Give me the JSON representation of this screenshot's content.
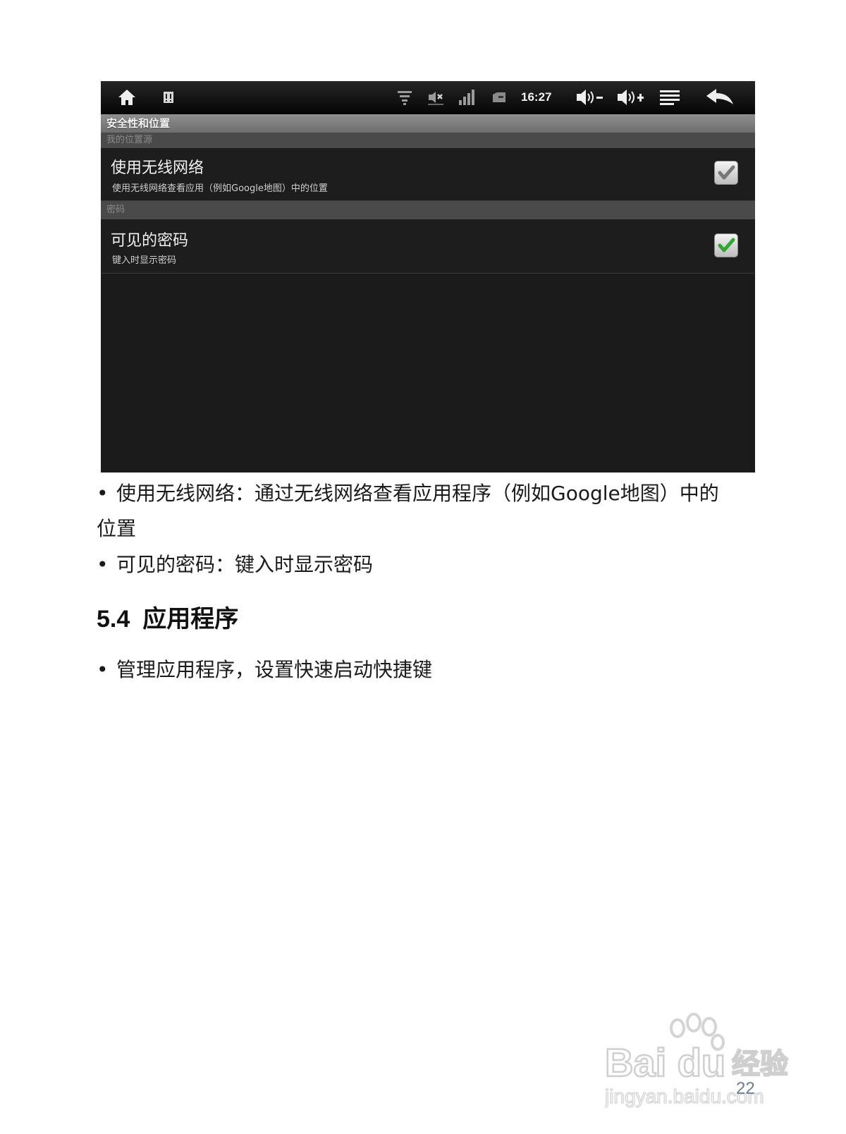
{
  "screenshot": {
    "statusbar": {
      "time": "16:27",
      "icons": [
        "home-icon",
        "notification-icon",
        "wifi-icon",
        "mute-icon",
        "signal-icon",
        "battery-icon",
        "volume-down-icon",
        "volume-up-icon",
        "menu-icon",
        "back-icon"
      ]
    },
    "header_title": "安全性和位置",
    "section_location": "我的位置源",
    "wireless": {
      "title": "使用无线网络",
      "summary": "使用无线网络查看应用（例如Google地图）中的位置",
      "checked": true,
      "check_color": "#7a7a7a"
    },
    "section_password": "密码",
    "visible_password": {
      "title": "可见的密码",
      "summary": "键入时显示密码",
      "checked": true,
      "check_color": "#2fa82f"
    }
  },
  "document": {
    "bullet_symbol": "•",
    "bullet1_line1": "使用无线网络：通过无线网络查看应用程序（例如Google地图）中的",
    "bullet1_line2": "位置",
    "bullet2": "可见的密码：键入时显示密码",
    "section_number": "5.4",
    "section_title": "应用程序",
    "bullet3": "管理应用程序，设置快速启动快捷键"
  },
  "watermark": {
    "brand": "Bai du",
    "brand_cn": "经验",
    "url": "jingyan.baidu.com"
  },
  "page_number": "22"
}
